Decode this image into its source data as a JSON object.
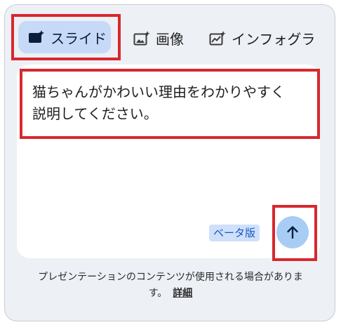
{
  "tabs": {
    "slides_label": "スライド",
    "image_label": "画像",
    "infographic_label": "インフォグラ"
  },
  "prompt": {
    "text": "猫ちゃんがかわいい理由をわかりやすく\n説明してください。"
  },
  "badge": {
    "beta_label": "ベータ版"
  },
  "footer": {
    "notice_line1": "プレゼンテーションのコンテンツが使用される場合がありま",
    "notice_line2": "す。",
    "details_link": "詳細"
  },
  "icons": {
    "slides": "slides-icon",
    "image": "image-sparkle-icon",
    "infographic": "chart-sparkle-icon",
    "send": "arrow-up-icon"
  },
  "colors": {
    "panel_bg": "#edf0f5",
    "selected_tab_bg": "#c6daf8",
    "send_button_bg": "#a8cdf5",
    "beta_badge_bg": "#cfe0fb",
    "beta_badge_text": "#1a56c2",
    "highlight_outline": "#d7282f"
  }
}
